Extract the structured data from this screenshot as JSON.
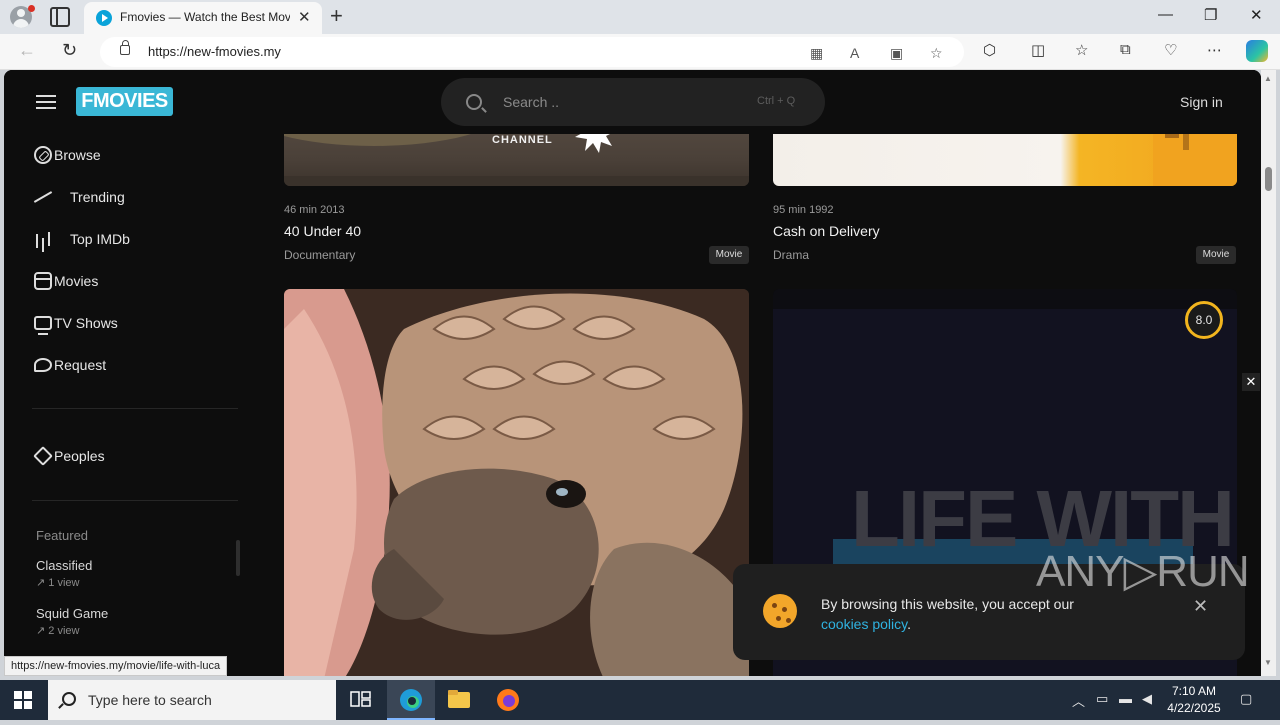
{
  "browser": {
    "tab_title": "Fmovies — Watch the Best Movies",
    "tab_close": "✕",
    "new_tab": "+",
    "url": "https://new-fmovies.my",
    "win_min": "—",
    "win_max": "❐",
    "win_close": "✕"
  },
  "header": {
    "logo": "FMOVIES",
    "search_placeholder": "Search ..",
    "search_hint": "Ctrl + Q",
    "signin": "Sign in"
  },
  "sidebar": {
    "items": [
      {
        "label": "Browse"
      },
      {
        "label": "Trending"
      },
      {
        "label": "Top IMDb"
      },
      {
        "label": "Movies"
      },
      {
        "label": "TV Shows"
      },
      {
        "label": "Request"
      }
    ],
    "peoples": "Peoples",
    "featured_heading": "Featured",
    "featured": [
      {
        "title": "Classified",
        "views": "1 view"
      },
      {
        "title": "Squid Game",
        "views": "2 view"
      }
    ]
  },
  "cards": [
    {
      "meta": "46 min 2013",
      "title": "40 Under 40",
      "genre": "Documentary",
      "badge": "Movie",
      "poster_text": "CHANNEL"
    },
    {
      "meta": "95 min 1992",
      "title": "Cash on Delivery",
      "genre": "Drama",
      "badge": "Movie"
    },
    {
      "poster_text": ""
    },
    {
      "rating": "8.0",
      "poster_text": "LIFE WITH"
    }
  ],
  "overlay_close": "✕",
  "cookie": {
    "text": "By browsing this website, you accept our",
    "link": "cookies policy",
    "suffix": ".",
    "close": "✕"
  },
  "watermark": "ANY▷RUN",
  "status_url": "https://new-fmovies.my/movie/life-with-luca",
  "taskbar": {
    "search_text": "Type here to search",
    "time": "7:10 AM",
    "date": "4/22/2025"
  },
  "colors": {
    "logo": "#3ab7d6",
    "rating_ring": "#f2b51e",
    "cookie_link": "#2fb2e0"
  }
}
